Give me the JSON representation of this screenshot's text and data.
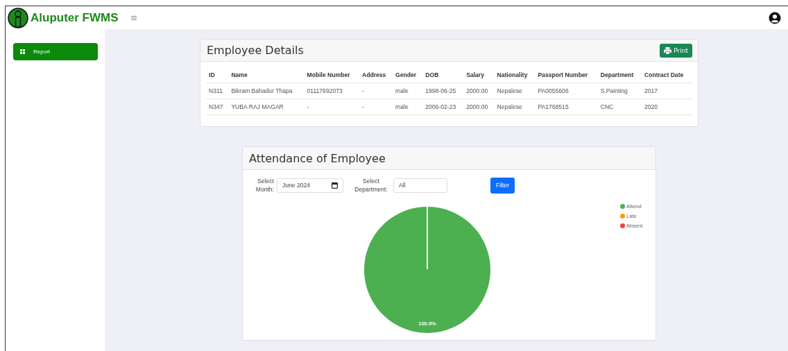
{
  "brand": {
    "title": "Aluputer FWMS"
  },
  "sidebar": {
    "items": [
      {
        "label": "Report",
        "selected": true
      }
    ]
  },
  "employee_details": {
    "title": "Employee Details",
    "print_button": "Print",
    "table": {
      "columns": [
        "ID",
        "Name",
        "Mobile Number",
        "Address",
        "Gender",
        "DOB",
        "Salary",
        "Nationality",
        "Passport Number",
        "Department",
        "Contract Date"
      ],
      "rows": [
        [
          "N311",
          "Bikram Bahadur Thapa",
          "01117692073",
          "-",
          "male",
          "1998-06-25",
          "2000.00",
          "Nepalese",
          "PA0055606",
          "S.Painting",
          "2017"
        ],
        [
          "N347",
          "YUBA RAJ MAGAR",
          "-",
          "-",
          "male",
          "2006-02-23",
          "2000.00",
          "Nepalese",
          "PA1768515",
          "CNC",
          "2020"
        ]
      ]
    }
  },
  "attendance": {
    "title": "Attendance of Employee",
    "month": {
      "label": "Select Month:",
      "value": "June 2024"
    },
    "department": {
      "label": "Select Department:",
      "value": "All"
    },
    "filter_button": "Filter",
    "chart_data": {
      "type": "pie",
      "categories": [
        "Attend",
        "Late",
        "Absent"
      ],
      "values": [
        100,
        0,
        0
      ],
      "colors": [
        "#4caf50",
        "#ff9800",
        "#f44336"
      ],
      "value_labels": [
        "100.0%",
        null,
        null
      ]
    }
  }
}
